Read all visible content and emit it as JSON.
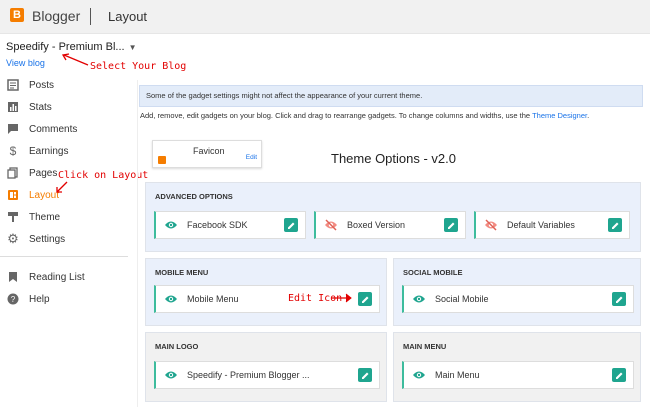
{
  "header": {
    "brand": "Blogger",
    "page": "Layout"
  },
  "sidebar": {
    "blog_name": "Speedify - Premium Bl...",
    "view_blog": "View blog",
    "items": [
      {
        "label": "Posts",
        "icon": "posts-icon"
      },
      {
        "label": "Stats",
        "icon": "stats-icon"
      },
      {
        "label": "Comments",
        "icon": "comments-icon"
      },
      {
        "label": "Earnings",
        "icon": "earnings-icon"
      },
      {
        "label": "Pages",
        "icon": "pages-icon"
      },
      {
        "label": "Layout",
        "icon": "layout-icon",
        "active": true
      },
      {
        "label": "Theme",
        "icon": "theme-icon"
      },
      {
        "label": "Settings",
        "icon": "gear-icon"
      }
    ],
    "secondary": [
      {
        "label": "Reading List",
        "icon": "bookmark-icon"
      },
      {
        "label": "Help",
        "icon": "help-icon"
      }
    ]
  },
  "annotations": {
    "select_blog": "Select Your Blog",
    "click_layout": "Click on Layout",
    "edit_icon": "Edit Icon"
  },
  "main": {
    "notice": "Some of the gadget settings might not affect the appearance of your current theme.",
    "help_text": "Add, remove, edit gadgets on your blog. Click and drag to rearrange gadgets. To change columns and widths, use the",
    "help_link": "Theme Designer",
    "help_end": ".",
    "favicon": {
      "title": "Favicon",
      "edit": "Edit"
    },
    "theme_title": "Theme Options - v2.0",
    "sections": {
      "advanced": {
        "title": "ADVANCED OPTIONS",
        "gadgets": [
          "Facebook SDK",
          "Boxed Version",
          "Default Variables"
        ]
      },
      "mobile_menu": {
        "title": "MOBILE MENU",
        "gadget": "Mobile Menu"
      },
      "social_mobile": {
        "title": "SOCIAL MOBILE",
        "gadget": "Social Mobile"
      },
      "main_logo": {
        "title": "MAIN LOGO",
        "gadget": "Speedify - Premium Blogger ..."
      },
      "main_menu": {
        "title": "MAIN MENU",
        "gadget": "Main Menu"
      }
    }
  },
  "colors": {
    "accent": "#f57d00",
    "edit": "#1fa58f",
    "link": "#1a73e8",
    "annotation": "#e20000"
  }
}
